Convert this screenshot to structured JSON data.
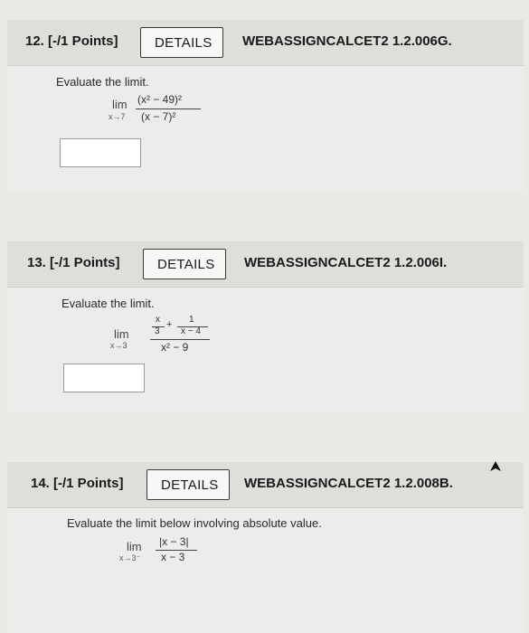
{
  "questions": [
    {
      "number_label": "12. [-/1 Points]",
      "details_label": "DETAILS",
      "code": "WEBASSIGNCALCET2 1.2.006G.",
      "prompt": "Evaluate the limit.",
      "math": {
        "lim": "lim",
        "sub": "x→7",
        "numerator": "(x² − 49)²",
        "denominator": "(x − 7)²"
      },
      "answer_value": ""
    },
    {
      "number_label": "13. [-/1 Points]",
      "details_label": "DETAILS",
      "code": "WEBASSIGNCALCET2 1.2.006I.",
      "prompt": "Evaluate the limit.",
      "math": {
        "lim": "lim",
        "sub": "x→3",
        "numerator_left": "x",
        "numerator_left_den": "3",
        "plus": "+",
        "numerator_right": "1",
        "numerator_right_den": "x − 4",
        "denominator": "x² − 9"
      },
      "answer_value": ""
    },
    {
      "number_label": "14. [-/1 Points]",
      "details_label": "DETAILS",
      "code": "WEBASSIGNCALCET2 1.2.008B.",
      "prompt": "Evaluate the limit below involving absolute value.",
      "math": {
        "lim": "lim",
        "sub": "x→3⁻",
        "numerator": "|x − 3|",
        "denominator": "x − 3"
      }
    }
  ]
}
